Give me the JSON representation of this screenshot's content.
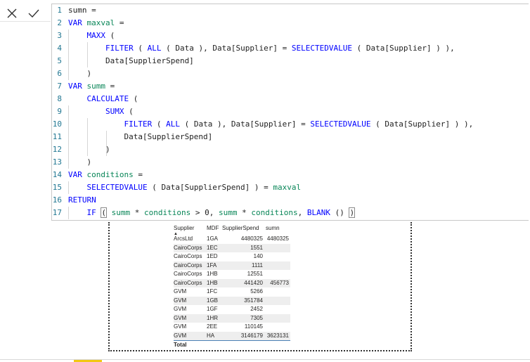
{
  "formula_bar": {
    "cancel_icon": "close-icon",
    "commit_icon": "checkmark-icon"
  },
  "code_lines": [
    {
      "n": "1",
      "t": "sumn ="
    },
    {
      "n": "2",
      "t": "VAR maxval ="
    },
    {
      "n": "3",
      "t": "    MAXX ("
    },
    {
      "n": "4",
      "t": "        FILTER ( ALL ( Data ), Data[Supplier] = SELECTEDVALUE ( Data[Supplier] ) ),"
    },
    {
      "n": "5",
      "t": "        Data[SupplierSpend]"
    },
    {
      "n": "6",
      "t": "    )"
    },
    {
      "n": "7",
      "t": "VAR summ ="
    },
    {
      "n": "8",
      "t": "    CALCULATE ("
    },
    {
      "n": "9",
      "t": "        SUMX ("
    },
    {
      "n": "10",
      "t": "            FILTER ( ALL ( Data ), Data[Supplier] = SELECTEDVALUE ( Data[Supplier] ) ),"
    },
    {
      "n": "11",
      "t": "            Data[SupplierSpend]"
    },
    {
      "n": "12",
      "t": "        )"
    },
    {
      "n": "13",
      "t": "    )"
    },
    {
      "n": "14",
      "t": "VAR conditions ="
    },
    {
      "n": "15",
      "t": "    SELECTEDVALUE ( Data[SupplierSpend] ) = maxval"
    },
    {
      "n": "16",
      "t": "RETURN"
    },
    {
      "n": "17",
      "t": "    IF ( summ * conditions > 0, summ * conditions, BLANK () )"
    }
  ],
  "table": {
    "headers": {
      "supplier": "Supplier",
      "mdf": "MDF",
      "spend": "SupplierSpend",
      "sumn": "sumn"
    },
    "rows": [
      {
        "supplier": "ArcsLtd",
        "mdf": "1GA",
        "spend": "4480325",
        "sumn": "4480325"
      },
      {
        "supplier": "CairoCorps",
        "mdf": "1EC",
        "spend": "1551",
        "sumn": ""
      },
      {
        "supplier": "CairoCorps",
        "mdf": "1ED",
        "spend": "140",
        "sumn": ""
      },
      {
        "supplier": "CairoCorps",
        "mdf": "1FA",
        "spend": "1111",
        "sumn": ""
      },
      {
        "supplier": "CairoCorps",
        "mdf": "1HB",
        "spend": "12551",
        "sumn": ""
      },
      {
        "supplier": "CairoCorps",
        "mdf": "1HB",
        "spend": "441420",
        "sumn": "456773"
      },
      {
        "supplier": "GVM",
        "mdf": "1FC",
        "spend": "5266",
        "sumn": ""
      },
      {
        "supplier": "GVM",
        "mdf": "1GB",
        "spend": "351784",
        "sumn": ""
      },
      {
        "supplier": "GVM",
        "mdf": "1GF",
        "spend": "2452",
        "sumn": ""
      },
      {
        "supplier": "GVM",
        "mdf": "1HR",
        "spend": "7305",
        "sumn": ""
      },
      {
        "supplier": "GVM",
        "mdf": "2EE",
        "spend": "110145",
        "sumn": ""
      },
      {
        "supplier": "GVM",
        "mdf": "HA",
        "spend": "3146179",
        "sumn": "3623131"
      }
    ],
    "total_label": "Total"
  },
  "colors": {
    "keyword": "#0000ff",
    "identifier": "#098658",
    "line_number": "#237893",
    "accent": "#f2c811"
  }
}
